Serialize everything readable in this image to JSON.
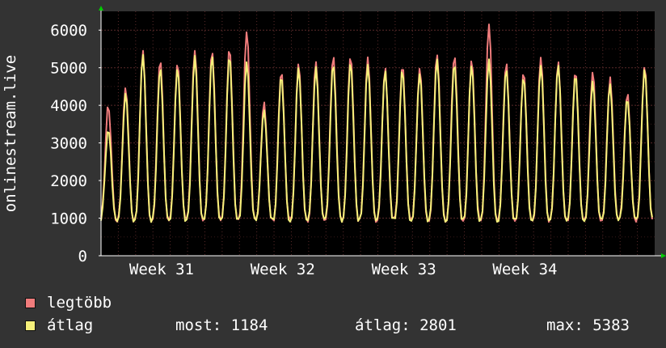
{
  "chart_data": {
    "type": "line",
    "ylabel": "onlinestream.live",
    "ylim": [
      0,
      6500
    ],
    "yticks": [
      0,
      1000,
      2000,
      3000,
      4000,
      5000,
      6000
    ],
    "x_tick_labels": [
      "Week 31",
      "Week 32",
      "Week 33",
      "Week 34"
    ],
    "grid": true,
    "period_days": 1,
    "series": [
      {
        "name": "legtöbb",
        "color": "#f07c7c",
        "daily_peaks": [
          4000,
          4500,
          5450,
          5200,
          5150,
          5450,
          5450,
          5500,
          6000,
          4100,
          4950,
          5100,
          5150,
          5300,
          5300,
          5250,
          5000,
          5100,
          5000,
          5400,
          5350,
          5200,
          6150,
          5150,
          4900,
          5250,
          5200,
          4950,
          4900,
          4700,
          4350,
          5100
        ]
      },
      {
        "name": "átlag",
        "color": "#f5f07a",
        "daily_peaks": [
          3400,
          4300,
          5350,
          5000,
          5000,
          5300,
          5300,
          5300,
          5200,
          3900,
          4800,
          5000,
          5000,
          5100,
          5150,
          5100,
          4900,
          4950,
          4850,
          5200,
          5150,
          5100,
          5200,
          5000,
          4800,
          5100,
          5100,
          4800,
          4650,
          4550,
          4200,
          4950
        ]
      }
    ]
  },
  "legend": [
    {
      "label": "legtöbb",
      "color": "#f07c7c"
    },
    {
      "label": "átlag",
      "color": "#f5f07a"
    }
  ],
  "stats": {
    "now": "most: 1184",
    "avg": "átlag: 2801",
    "max": "max: 5383"
  },
  "colors": {
    "background": "#333333",
    "plot_background": "#000000",
    "grid": "#5a2a2a",
    "axis": "#ffffff",
    "arrow": "#00cc00"
  }
}
